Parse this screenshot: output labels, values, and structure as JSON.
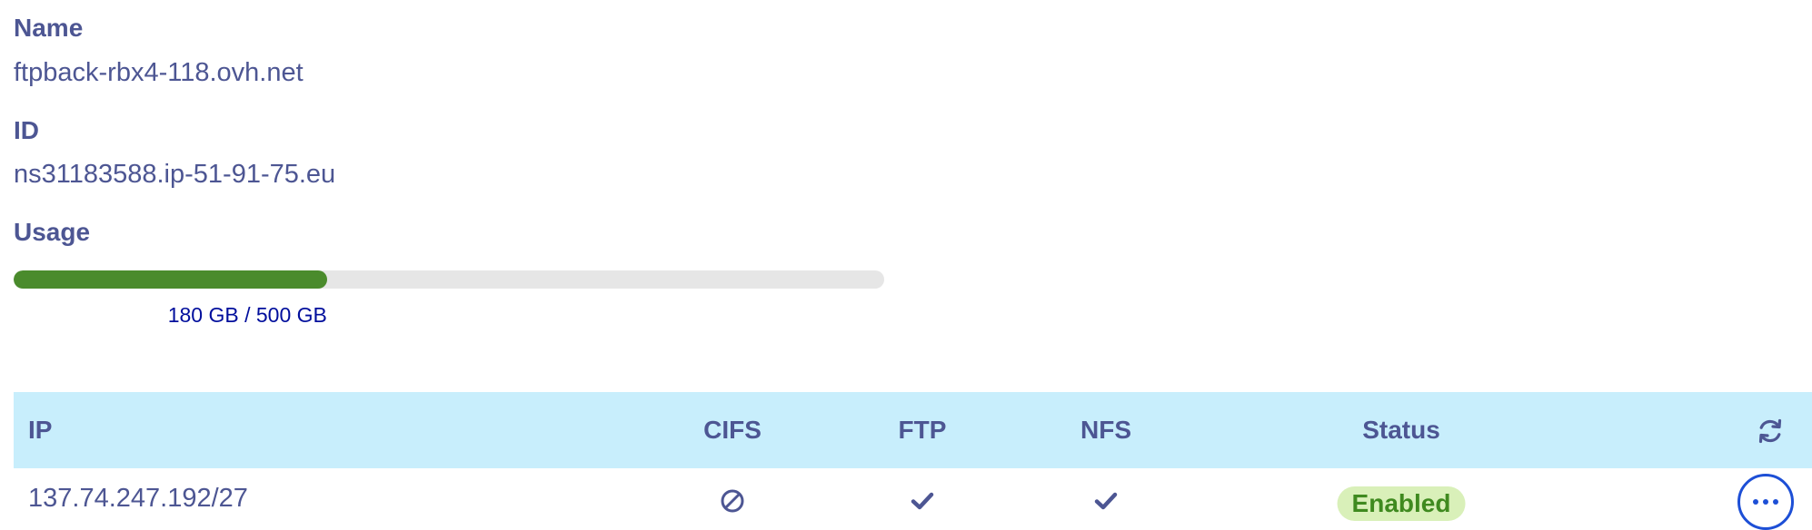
{
  "details": {
    "name_label": "Name",
    "name_value": "ftpback-rbx4-118.ovh.net",
    "id_label": "ID",
    "id_value": "ns31183588.ip-51-91-75.eu",
    "usage_label": "Usage",
    "usage_fraction": 0.36,
    "usage_text": "180 GB / 500 GB"
  },
  "table": {
    "headers": {
      "ip": "IP",
      "cifs": "CIFS",
      "ftp": "FTP",
      "nfs": "NFS",
      "status": "Status"
    },
    "refresh_icon": "refresh-icon",
    "rows": [
      {
        "ip": "137.74.247.192/27",
        "cifs_icon": "ban-icon",
        "ftp_icon": "check-icon",
        "nfs_icon": "check-icon",
        "status": "Enabled",
        "actions_icon": "ellipsis-icon"
      }
    ]
  },
  "colors": {
    "text": "#4d5693",
    "header_bg": "#c8eefc",
    "bar_fill": "#4a8b2c",
    "bar_track": "#e6e6e6",
    "badge_bg": "#d9f0b9",
    "badge_text": "#3f8a1f",
    "action_blue": "#1d4fd6",
    "usage_text": "#000e9c"
  }
}
